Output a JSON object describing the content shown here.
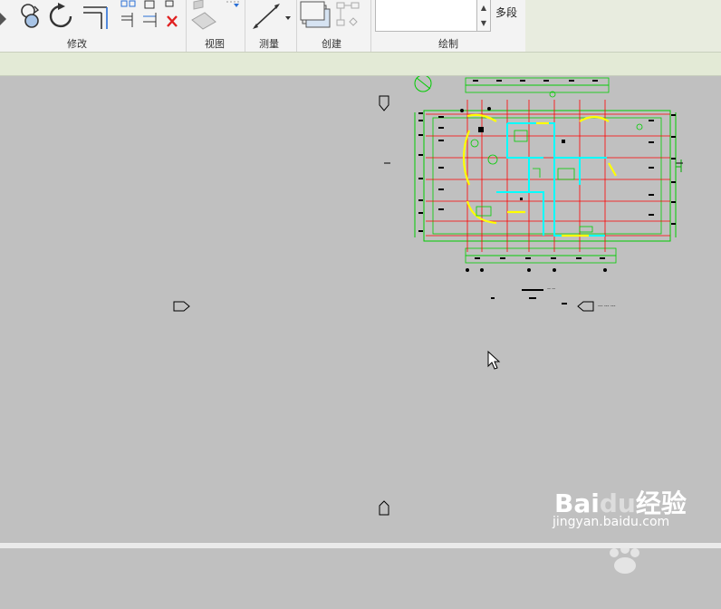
{
  "ribbon": {
    "panels": {
      "modify_label": "修改",
      "view_label": "视图",
      "measure_label": "测量",
      "create_label": "创建",
      "draw_label": "绘制"
    },
    "type_selector_value": "",
    "multi_segment_label": "多段"
  },
  "canvas": {
    "background": "#c0c0c0",
    "plan_colors": {
      "grid": "#00ff00",
      "axis": "#ff0000",
      "walls": "#00ffff",
      "highlight": "#ffff00",
      "ink": "#000000"
    }
  },
  "watermark": {
    "brand": "Bai",
    "brand_suffix": "经验",
    "url": "jingyan.baidu.com"
  }
}
